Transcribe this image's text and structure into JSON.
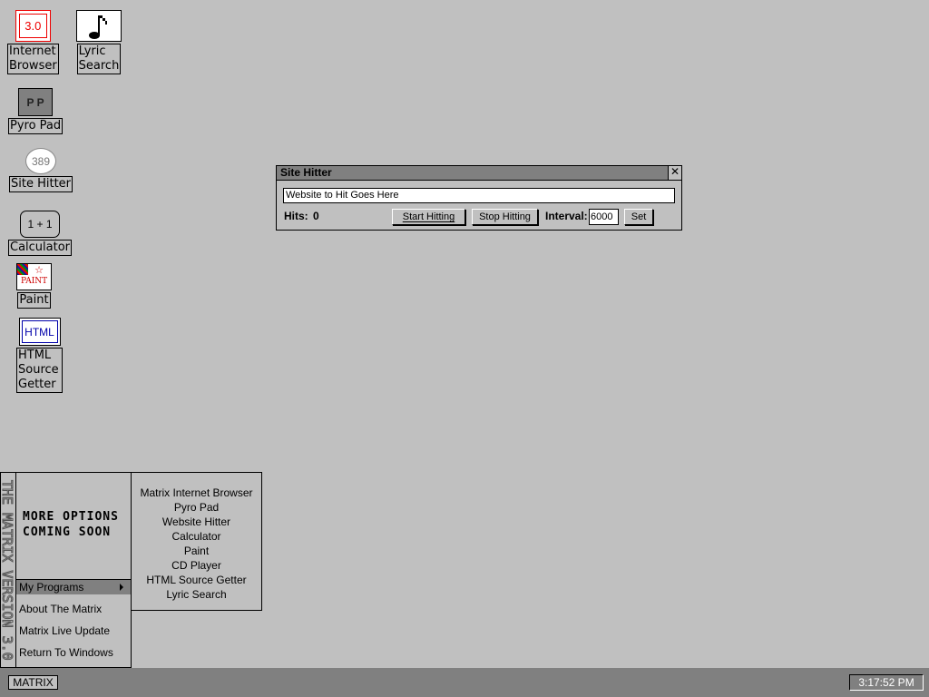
{
  "desktop": {
    "icons": [
      {
        "label": "Internet\nBrowser",
        "glyph": "3.0"
      },
      {
        "label": "Lyric\nSearch",
        "glyph": "♪"
      },
      {
        "label": "Pyro Pad",
        "glyph": "P P"
      },
      {
        "label": "Site Hitter",
        "glyph": "389"
      },
      {
        "label": "Calculator",
        "glyph": "1 + 1"
      },
      {
        "label": "Paint",
        "glyph": "PAINT"
      },
      {
        "label": "HTML\nSource\nGetter",
        "glyph": "HTML"
      }
    ]
  },
  "window": {
    "title": "Site Hitter",
    "close_glyph": "✕",
    "url_value": "Website to Hit Goes Here",
    "hits_label": "Hits:",
    "hits_value": "0",
    "start_button": "Start Hitting",
    "stop_button": "Stop Hitting",
    "interval_label": "Interval:",
    "interval_value": "6000",
    "set_button": "Set"
  },
  "start_menu": {
    "side_text": "THE MATRIX VERSION 3.0",
    "banner": "MORE OPTIONS\nCOMING SOON",
    "items": [
      "My Programs",
      "About The Matrix",
      "Matrix Live Update",
      "Return To Windows"
    ],
    "submenu": [
      "Matrix Internet Browser",
      "Pyro Pad",
      "Website Hitter",
      "Calculator",
      "Paint",
      "CD Player",
      "HTML Source Getter",
      "Lyric Search"
    ]
  },
  "taskbar": {
    "start_label": "MATRIX",
    "clock": "3:17:52 PM"
  },
  "colors": {
    "desktop": "#c0c0c0",
    "taskbar": "#808080",
    "title_bar": "#808080",
    "highlight": "#808080"
  }
}
